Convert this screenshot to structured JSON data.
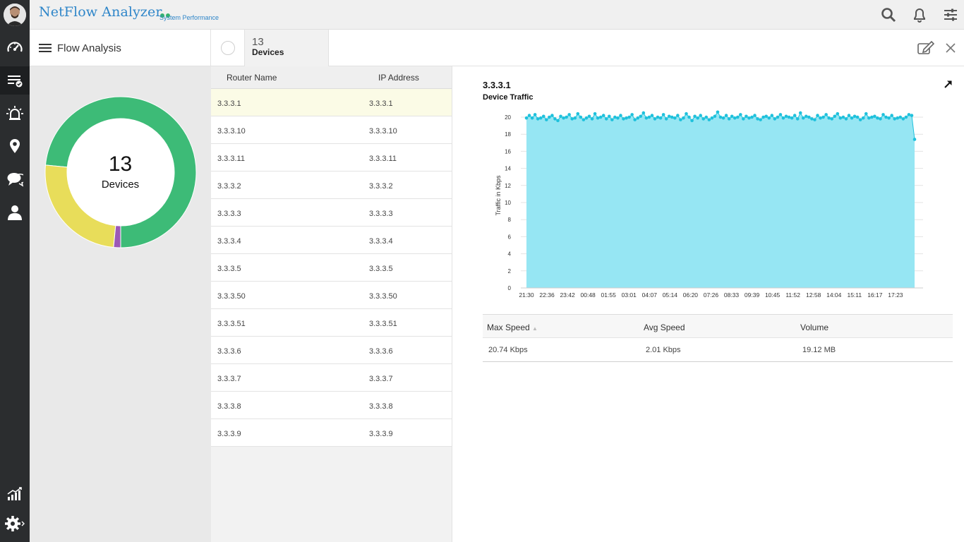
{
  "app": {
    "title": "NetFlow Analyzer",
    "subtitle": "System Performance",
    "accent": "#2f86c9"
  },
  "rail": {
    "items": [
      {
        "icon": "dashboard-gauge-icon"
      },
      {
        "icon": "inventory-list-icon",
        "active": true
      },
      {
        "icon": "alarm-icon"
      },
      {
        "icon": "map-pin-icon"
      },
      {
        "icon": "chat-bubbles-icon"
      },
      {
        "icon": "user-icon"
      },
      {
        "icon": "reports-chart-icon"
      },
      {
        "icon": "settings-gear-icon"
      }
    ]
  },
  "header": {
    "icons": [
      "search-icon",
      "bell-icon",
      "sliders-icon"
    ]
  },
  "subbar": {
    "menu_title": "Flow Analysis",
    "devices_count": "13",
    "devices_label": "Devices"
  },
  "donut": {
    "center_value": "13",
    "center_label": "Devices",
    "segments": [
      {
        "status": "clear",
        "color": "#3dbb77",
        "fraction": 0.735
      },
      {
        "status": "attention",
        "color": "#e8dd5a",
        "fraction": 0.25
      },
      {
        "status": "trouble",
        "color": "#9b59b6",
        "fraction": 0.015
      }
    ]
  },
  "router_list": {
    "columns": [
      "Router Name",
      "IP Address"
    ],
    "rows": [
      {
        "name": "3.3.3.1",
        "ip": "3.3.3.1"
      },
      {
        "name": "3.3.3.10",
        "ip": "3.3.3.10"
      },
      {
        "name": "3.3.3.11",
        "ip": "3.3.3.11"
      },
      {
        "name": "3.3.3.2",
        "ip": "3.3.3.2"
      },
      {
        "name": "3.3.3.3",
        "ip": "3.3.3.3"
      },
      {
        "name": "3.3.3.4",
        "ip": "3.3.3.4"
      },
      {
        "name": "3.3.3.5",
        "ip": "3.3.3.5"
      },
      {
        "name": "3.3.3.50",
        "ip": "3.3.3.50"
      },
      {
        "name": "3.3.3.51",
        "ip": "3.3.3.51"
      },
      {
        "name": "3.3.3.6",
        "ip": "3.3.3.6"
      },
      {
        "name": "3.3.3.7",
        "ip": "3.3.3.7"
      },
      {
        "name": "3.3.3.8",
        "ip": "3.3.3.8"
      },
      {
        "name": "3.3.3.9",
        "ip": "3.3.3.9"
      }
    ],
    "selected": "3.3.3.1"
  },
  "detail": {
    "device": "3.3.3.1",
    "chart_title": "Device Traffic"
  },
  "chart_data": {
    "type": "area",
    "ylabel": "Traffic in Kbps",
    "ylim": [
      0,
      20
    ],
    "yticks": [
      0,
      2,
      4,
      6,
      8,
      10,
      12,
      14,
      16,
      18,
      20
    ],
    "xticks": [
      "21:30",
      "22:36",
      "23:42",
      "00:48",
      "01:55",
      "03:01",
      "04:07",
      "05:14",
      "06:20",
      "07:26",
      "08:33",
      "09:39",
      "10:45",
      "11:52",
      "12:58",
      "14:04",
      "15:11",
      "16:17",
      "17:23"
    ],
    "grid": true,
    "fill_color": "#96e6f3",
    "line_color": "#1fc1dc",
    "series": [
      {
        "values": [
          19.9,
          20.2,
          19.9,
          20.3,
          19.8,
          19.9,
          20.1,
          19.7,
          20.0,
          20.2,
          19.8,
          19.6,
          20.1,
          19.9,
          20.0,
          20.3,
          19.8,
          19.9,
          20.4,
          20.0,
          19.7,
          19.9,
          20.1,
          19.8,
          20.4,
          19.9,
          20.0,
          20.2,
          19.8,
          20.1,
          19.7,
          20.0,
          19.9,
          20.2,
          19.8,
          19.9,
          20.0,
          20.3,
          19.7,
          19.9,
          20.1,
          20.5,
          19.9,
          20.0,
          20.2,
          19.8,
          20.0,
          19.9,
          20.3,
          19.8,
          20.1,
          20.0,
          19.9,
          20.2,
          19.7,
          19.9,
          20.4,
          20.0,
          19.6,
          20.1,
          19.9,
          20.2,
          19.8,
          20.0,
          19.7,
          19.9,
          20.1,
          20.6,
          20.0,
          19.9,
          20.2,
          19.8,
          20.1,
          19.9,
          20.0,
          20.3,
          19.8,
          20.1,
          19.9,
          20.0,
          20.2,
          19.8,
          19.7,
          20.0,
          20.1,
          19.9,
          20.2,
          19.8,
          20.0,
          20.3,
          19.9,
          20.1,
          20.0,
          19.9,
          20.2,
          19.8,
          20.5,
          19.9,
          20.1,
          20.0,
          19.8,
          19.7,
          20.2,
          19.9,
          20.0,
          20.3,
          19.9,
          19.8,
          20.1,
          20.4,
          19.9,
          20.0,
          19.8,
          20.2,
          19.9,
          20.1,
          20.0,
          19.7,
          19.9,
          20.4,
          19.9,
          20.0,
          20.1,
          19.9,
          19.8,
          20.3,
          20.0,
          19.9,
          20.2,
          19.8,
          19.9,
          20.0,
          19.8,
          20.0,
          20.3,
          20.2,
          17.4
        ]
      }
    ]
  },
  "stats": {
    "columns": [
      "Max Speed",
      "Avg Speed",
      "Volume"
    ],
    "values": [
      "20.74 Kbps",
      "2.01 Kbps",
      "19.12 MB"
    ]
  }
}
